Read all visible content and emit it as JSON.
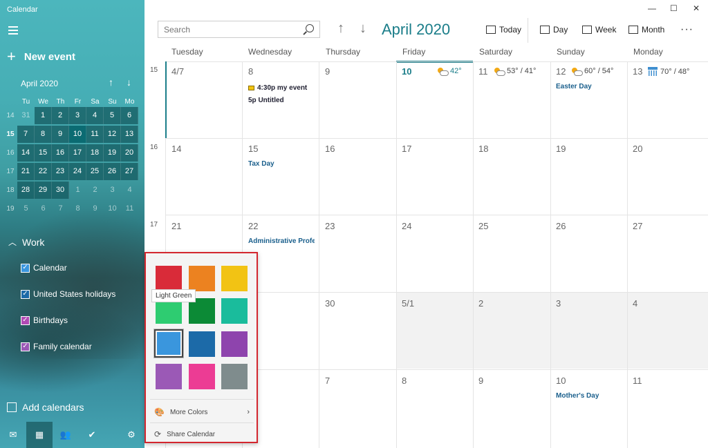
{
  "app": {
    "title": "Calendar"
  },
  "sidebar": {
    "new_event": "New event",
    "mini_month": "April 2020",
    "weekdays": [
      "Tu",
      "We",
      "Th",
      "Fr",
      "Sa",
      "Su",
      "Mo"
    ],
    "weeks": [
      {
        "num": "14",
        "days": [
          "31",
          "1",
          "2",
          "3",
          "4",
          "5",
          "6"
        ]
      },
      {
        "num": "15",
        "days": [
          "7",
          "8",
          "9",
          "10",
          "11",
          "12",
          "13"
        ]
      },
      {
        "num": "16",
        "days": [
          "14",
          "15",
          "16",
          "17",
          "18",
          "19",
          "20"
        ]
      },
      {
        "num": "17",
        "days": [
          "21",
          "22",
          "23",
          "24",
          "25",
          "26",
          "27"
        ]
      },
      {
        "num": "18",
        "days": [
          "28",
          "29",
          "30",
          "1",
          "2",
          "3",
          "4"
        ]
      },
      {
        "num": "19",
        "days": [
          "5",
          "6",
          "7",
          "8",
          "9",
          "10",
          "11"
        ]
      }
    ],
    "group": "Work",
    "calendars": [
      "Calendar",
      "United States holidays",
      "Birthdays",
      "Family calendar"
    ],
    "add_calendars": "Add calendars"
  },
  "toolbar": {
    "search_placeholder": "Search",
    "month_title": "April 2020",
    "today": "Today",
    "day": "Day",
    "week": "Week",
    "month": "Month",
    "more": "···"
  },
  "grid": {
    "day_headers": [
      "Tuesday",
      "Wednesday",
      "Thursday",
      "Friday",
      "Saturday",
      "Sunday",
      "Monday"
    ],
    "week_numbers": [
      "15",
      "16",
      "17"
    ],
    "rows": [
      [
        "4/7",
        "8",
        "9",
        "10",
        "11",
        "12",
        "13"
      ],
      [
        "14",
        "15",
        "16",
        "17",
        "18",
        "19",
        "20"
      ],
      [
        "21",
        "22",
        "23",
        "24",
        "25",
        "26",
        "27"
      ],
      [
        "",
        "",
        "30",
        "5/1",
        "2",
        "3",
        "4"
      ],
      [
        "",
        "",
        "7",
        "8",
        "9",
        "10",
        "11"
      ]
    ],
    "weather": [
      {
        "col": 3,
        "temp": "42°",
        "icon": "sun-cloud-icon"
      },
      {
        "col": 4,
        "temp": "53° / 41°",
        "icon": "sun-cloud-icon"
      },
      {
        "col": 5,
        "temp": "60° / 54°",
        "icon": "sun-cloud-icon"
      },
      {
        "col": 6,
        "temp": "70° / 48°",
        "icon": "rain-icon"
      }
    ],
    "events": {
      "my_event": "4:30p my event",
      "untitled": "5p Untitled",
      "easter": "Easter Day",
      "tax": "Tax Day",
      "admin": "Administrative Professionals Day",
      "mothers": "Mother's Day"
    }
  },
  "picker": {
    "colors": [
      "#d92b39",
      "#ec8220",
      "#f2c314",
      "#2ecc71",
      "#0c8a36",
      "#1abc9c",
      "#3a96dd",
      "#1c6aa8",
      "#8e44ad",
      "#9b59b6",
      "#ec3c94",
      "#7f8c8d"
    ],
    "selected_index": 6,
    "tooltip": "Light Green",
    "more_colors": "More Colors",
    "share": "Share Calendar"
  }
}
